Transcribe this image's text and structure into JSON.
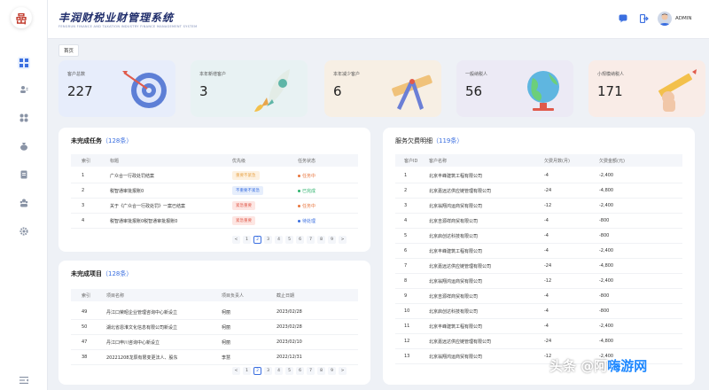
{
  "app": {
    "logo_glyph": "嵒",
    "title": "丰润财税业财管理系统",
    "subtitle": "FENGRUN FINANCE AND TAXATION INDUSTRY FINANCE MANAGEMENT SYSTEM",
    "user": "ADMIN"
  },
  "breadcrumb": "首页",
  "stats": [
    {
      "label": "客户总数",
      "value": "227",
      "bg": "#e7edfb",
      "art": "target"
    },
    {
      "label": "本年新增客户",
      "value": "3",
      "bg": "#e8f2f3",
      "art": "rocket"
    },
    {
      "label": "本年减少客户",
      "value": "6",
      "bg": "#f7efe4",
      "art": "ruler"
    },
    {
      "label": "一般纳税人",
      "value": "56",
      "bg": "#eceaf5",
      "art": "globe"
    },
    {
      "label": "小规模纳税人",
      "value": "171",
      "bg": "#f9ece7",
      "art": "pencil"
    }
  ],
  "tasks": {
    "title": "未完成任务",
    "count": "（128条）",
    "headers": [
      "索引",
      "标题",
      "优先级",
      "任务状态"
    ],
    "rows": [
      {
        "index": "1",
        "title": "广众合一行政处罚结案",
        "priority": "重要不紧急",
        "priority_color": "#e8a54b",
        "priority_bg": "#fdf1e0",
        "status": "任务中",
        "status_color": "#e8743b"
      },
      {
        "index": "2",
        "title": "税智通审批报账0",
        "priority": "不重要不紧急",
        "priority_color": "#3b6fe0",
        "priority_bg": "#e6eefc",
        "status": "已完成",
        "status_color": "#2fb36e"
      },
      {
        "index": "3",
        "title": "关于《广众合一行政处罚》一案已结案",
        "priority": "紧急重要",
        "priority_color": "#e05a4b",
        "priority_bg": "#fde6e3",
        "status": "任务中",
        "status_color": "#e8743b"
      },
      {
        "index": "4",
        "title": "税智通审批报账0税智通审批报账0",
        "priority": "紧急重要",
        "priority_color": "#e05a4b",
        "priority_bg": "#fde6e3",
        "status": "待处理",
        "status_color": "#3b6fe0"
      }
    ],
    "pages": [
      "<",
      "1",
      "2",
      "3",
      "4",
      "5",
      "6",
      "7",
      "8",
      "9",
      ">"
    ],
    "active_page": "2"
  },
  "projects": {
    "title": "未完成项目",
    "count": "（128条）",
    "headers": [
      "索引",
      "项目名称",
      "项目负责人",
      "截止日期"
    ],
    "rows": [
      {
        "index": "49",
        "name": "丹江口荣昭企业管理咨询中心新设立",
        "owner": "柯丽",
        "due": "2023/02/28"
      },
      {
        "index": "50",
        "name": "湖北省恩淮文化信息有限公司新设立",
        "owner": "柯丽",
        "due": "2023/02/28"
      },
      {
        "index": "47",
        "name": "丹江口申川咨询中心新设立",
        "owner": "柯丽",
        "due": "2023/02/10"
      },
      {
        "index": "38",
        "name": "20221208龙辰有限变更法人、股东",
        "owner": "李慧",
        "due": "2022/12/31"
      }
    ],
    "pages": [
      "<",
      "1",
      "2",
      "3",
      "4",
      "5",
      "6",
      "7",
      "8",
      "9",
      ">"
    ],
    "active_page": "2"
  },
  "arrears": {
    "title": "服务欠费明细",
    "count": "（119条）",
    "headers": [
      "客户ID",
      "客户名称",
      "欠费月数(月)",
      "欠费金额(元)"
    ],
    "rows": [
      {
        "id": "1",
        "name": "北京丰峰建筑工程有限公司",
        "months": "-4",
        "amount": "-2,400"
      },
      {
        "id": "2",
        "name": "北京嘉远达供应链管理有限公司",
        "months": "-24",
        "amount": "-4,800"
      },
      {
        "id": "3",
        "name": "北京翁翔鸿运商贸有限公司",
        "months": "-12",
        "amount": "-2,400"
      },
      {
        "id": "4",
        "name": "北京吉源祥商贸有限公司",
        "months": "-4",
        "amount": "-800"
      },
      {
        "id": "5",
        "name": "北京启创达科技有限公司",
        "months": "-4",
        "amount": "-800"
      },
      {
        "id": "6",
        "name": "北京丰峰建筑工程有限公司",
        "months": "-4",
        "amount": "-2,400"
      },
      {
        "id": "7",
        "name": "北京嘉远达供应链管理有限公司",
        "months": "-24",
        "amount": "-4,800"
      },
      {
        "id": "8",
        "name": "北京翁翔鸿运商贸有限公司",
        "months": "-12",
        "amount": "-2,400"
      },
      {
        "id": "9",
        "name": "北京吉源祥商贸有限公司",
        "months": "-4",
        "amount": "-800"
      },
      {
        "id": "10",
        "name": "北京启创达科技有限公司",
        "months": "-4",
        "amount": "-800"
      },
      {
        "id": "11",
        "name": "北京丰峰建筑工程有限公司",
        "months": "-4",
        "amount": "-2,400"
      },
      {
        "id": "12",
        "name": "北京嘉远达供应链管理有限公司",
        "months": "-24",
        "amount": "-4,800"
      },
      {
        "id": "13",
        "name": "北京翁翔鸿运商贸有限公司",
        "months": "-12",
        "amount": "-2,400"
      }
    ]
  },
  "watermark": {
    "prefix": "头条 @阿",
    "brand": "嗨游网"
  },
  "colors": {
    "accent": "#3b6fe0",
    "title": "#1f2d6b"
  }
}
